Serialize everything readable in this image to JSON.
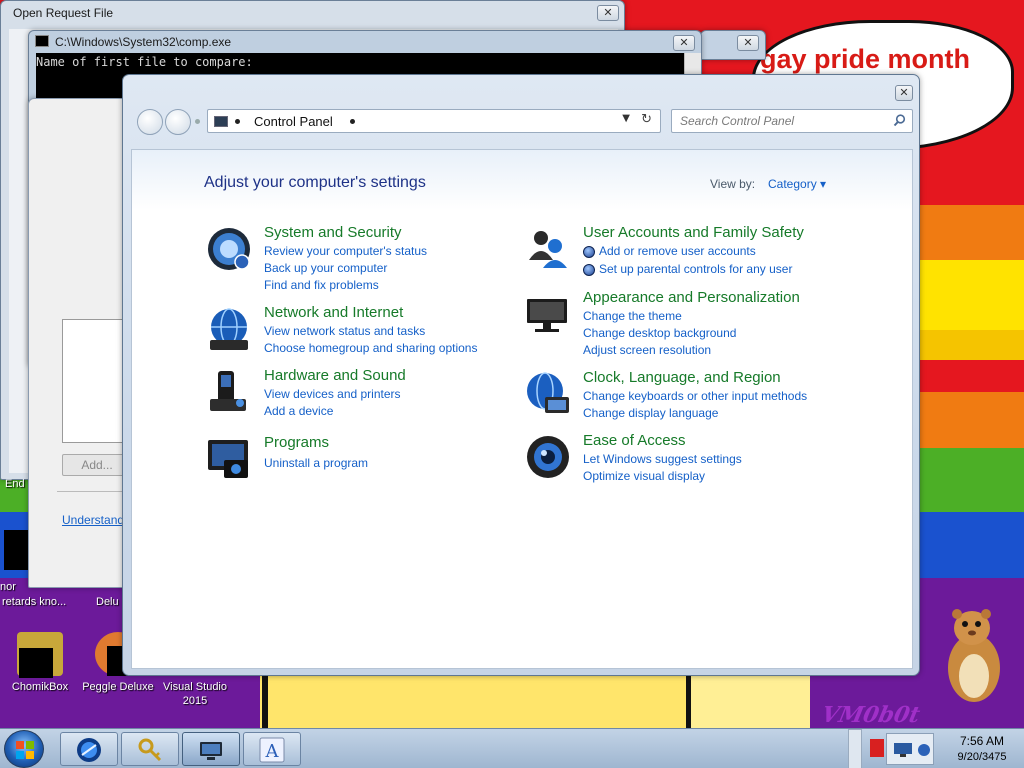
{
  "desktop": {
    "wallpaper_caption": "gay pride month",
    "watermark": "VM0b0t",
    "icons": [
      {
        "label": "ChomikBox"
      },
      {
        "label": "Peggle Deluxe"
      },
      {
        "label": "Visual Studio 2015"
      }
    ],
    "partial_icon_labels": [
      "nor",
      "retards kno...",
      "Delu"
    ]
  },
  "open_request_window": {
    "title": "Open Request File",
    "close_glyph": "✕"
  },
  "cmd_window": {
    "title": "C:\\Windows\\System32\\comp.exe",
    "console_line": "Name of first file to compare:",
    "close_glyph": "✕"
  },
  "background_window": {
    "close_glyph": "✕"
  },
  "dialog_window": {
    "add_button": "Add...",
    "understand_link": "Understand",
    "end_label": "End"
  },
  "control_panel": {
    "close_glyph": "✕",
    "address": {
      "breadcrumb": "Control Panel",
      "dropdown_glyph": "▼",
      "refresh_glyph": "↻"
    },
    "search": {
      "placeholder": "Search Control Panel"
    },
    "heading": "Adjust your computer's settings",
    "view_by": {
      "label": "View by:",
      "value": "Category ▾"
    },
    "categories": [
      {
        "icon": "system-security-icon",
        "title": "System and Security",
        "links": [
          "Review your computer's status",
          "Back up your computer",
          "Find and fix problems"
        ]
      },
      {
        "icon": "network-internet-icon",
        "title": "Network and Internet",
        "links": [
          "View network status and tasks",
          "Choose homegroup and sharing options"
        ]
      },
      {
        "icon": "hardware-sound-icon",
        "title": "Hardware and Sound",
        "links": [
          "View devices and printers",
          "Add a device"
        ]
      },
      {
        "icon": "programs-icon",
        "title": "Programs",
        "links": [
          "Uninstall a program"
        ]
      },
      {
        "icon": "user-accounts-icon",
        "title": "User Accounts and Family Safety",
        "links": [
          "Add or remove user accounts",
          "Set up parental controls for any user"
        ]
      },
      {
        "icon": "appearance-icon",
        "title": "Appearance and Personalization",
        "links": [
          "Change the theme",
          "Change desktop background",
          "Adjust screen resolution"
        ]
      },
      {
        "icon": "clock-region-icon",
        "title": "Clock, Language, and Region",
        "links": [
          "Change keyboards or other input methods",
          "Change display language"
        ]
      },
      {
        "icon": "ease-access-icon",
        "title": "Ease of Access",
        "links": [
          "Let Windows suggest settings",
          "Optimize visual display"
        ]
      }
    ]
  },
  "taskbar": {
    "time": "7:56 AM",
    "date": "9/20/3475",
    "pinned": [
      "internet-explorer-icon",
      "keys-icon",
      "control-panel-icon",
      "font-viewer-icon"
    ]
  },
  "colors": {
    "link_blue": "#1560c8",
    "category_green": "#167a29",
    "heading_navy": "#1e3287"
  }
}
